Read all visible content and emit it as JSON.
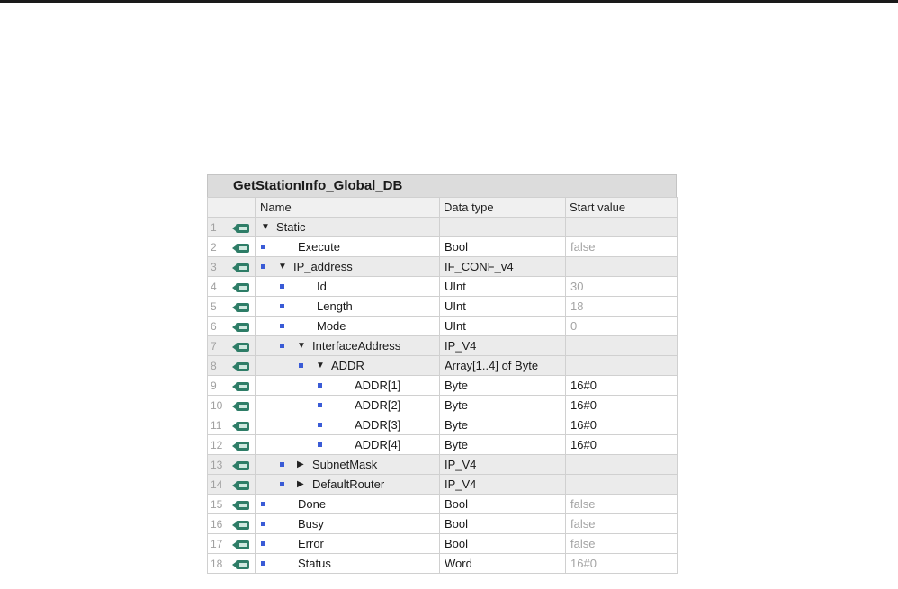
{
  "db": {
    "title": "GetStationInfo_Global_DB",
    "headers": {
      "name": "Name",
      "data_type": "Data type",
      "start_value": "Start value"
    },
    "rows": [
      {
        "num": "1",
        "level": 0,
        "bullet": false,
        "expander": "expanded",
        "name": "Static",
        "data_type": "",
        "start_value": "",
        "muted": false
      },
      {
        "num": "2",
        "level": 1,
        "bullet": true,
        "expander": "none",
        "name": "Execute",
        "data_type": "Bool",
        "start_value": "false",
        "muted": true
      },
      {
        "num": "3",
        "level": 1,
        "bullet": true,
        "expander": "expanded",
        "name": "IP_address",
        "data_type": "IF_CONF_v4",
        "start_value": "",
        "muted": false
      },
      {
        "num": "4",
        "level": 2,
        "bullet": true,
        "expander": "none",
        "name": "Id",
        "data_type": "UInt",
        "start_value": "30",
        "muted": true
      },
      {
        "num": "5",
        "level": 2,
        "bullet": true,
        "expander": "none",
        "name": "Length",
        "data_type": "UInt",
        "start_value": "18",
        "muted": true
      },
      {
        "num": "6",
        "level": 2,
        "bullet": true,
        "expander": "none",
        "name": "Mode",
        "data_type": "UInt",
        "start_value": "0",
        "muted": true
      },
      {
        "num": "7",
        "level": 2,
        "bullet": true,
        "expander": "expanded",
        "name": "InterfaceAddress",
        "data_type": "IP_V4",
        "start_value": "",
        "muted": false
      },
      {
        "num": "8",
        "level": 3,
        "bullet": true,
        "expander": "expanded",
        "name": "ADDR",
        "data_type": "Array[1..4] of Byte",
        "start_value": "",
        "muted": false
      },
      {
        "num": "9",
        "level": 4,
        "bullet": true,
        "expander": "none",
        "name": "ADDR[1]",
        "data_type": "Byte",
        "start_value": "16#0",
        "muted": false
      },
      {
        "num": "10",
        "level": 4,
        "bullet": true,
        "expander": "none",
        "name": "ADDR[2]",
        "data_type": "Byte",
        "start_value": "16#0",
        "muted": false
      },
      {
        "num": "11",
        "level": 4,
        "bullet": true,
        "expander": "none",
        "name": "ADDR[3]",
        "data_type": "Byte",
        "start_value": "16#0",
        "muted": false
      },
      {
        "num": "12",
        "level": 4,
        "bullet": true,
        "expander": "none",
        "name": "ADDR[4]",
        "data_type": "Byte",
        "start_value": "16#0",
        "muted": false
      },
      {
        "num": "13",
        "level": 2,
        "bullet": true,
        "expander": "collapsed",
        "name": "SubnetMask",
        "data_type": "IP_V4",
        "start_value": "",
        "muted": false
      },
      {
        "num": "14",
        "level": 2,
        "bullet": true,
        "expander": "collapsed",
        "name": "DefaultRouter",
        "data_type": "IP_V4",
        "start_value": "",
        "muted": false
      },
      {
        "num": "15",
        "level": 1,
        "bullet": true,
        "expander": "none",
        "name": "Done",
        "data_type": "Bool",
        "start_value": "false",
        "muted": true
      },
      {
        "num": "16",
        "level": 1,
        "bullet": true,
        "expander": "none",
        "name": "Busy",
        "data_type": "Bool",
        "start_value": "false",
        "muted": true
      },
      {
        "num": "17",
        "level": 1,
        "bullet": true,
        "expander": "none",
        "name": "Error",
        "data_type": "Bool",
        "start_value": "false",
        "muted": true
      },
      {
        "num": "18",
        "level": 1,
        "bullet": true,
        "expander": "none",
        "name": "Status",
        "data_type": "Word",
        "start_value": "16#0",
        "muted": true
      }
    ]
  },
  "colors": {
    "interface_icon": "#2e7d67",
    "bullet": "#3a5bd6",
    "row_alt": "#ebebeb",
    "muted_text": "#a4a4a4"
  },
  "icons": {
    "row_icon": "interface-static-icon",
    "bullet": "member-bullet-icon",
    "expanded": "expand-down-icon",
    "collapsed": "expand-right-icon"
  }
}
